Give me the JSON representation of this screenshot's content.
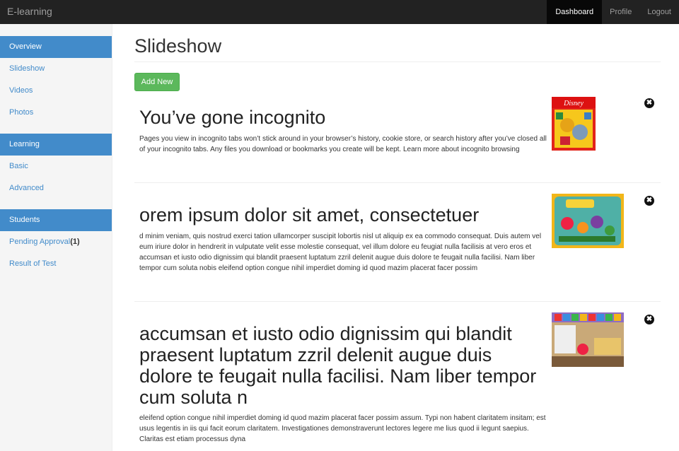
{
  "navbar": {
    "brand": "E-learning",
    "items": [
      {
        "label": "Dashboard",
        "active": true
      },
      {
        "label": "Profile",
        "active": false
      },
      {
        "label": "Logout",
        "active": false
      }
    ]
  },
  "sidebar": {
    "groups": [
      {
        "header": "Overview",
        "items": [
          "Slideshow",
          "Videos",
          "Photos"
        ]
      },
      {
        "header": "Learning",
        "items": [
          "Basic",
          "Advanced"
        ]
      },
      {
        "header": "Students",
        "items": [
          "Pending Approval",
          "Result of Test"
        ],
        "pending_count": "(1)"
      }
    ]
  },
  "main": {
    "title": "Slideshow",
    "add_button": "Add New",
    "close_glyph": "✖",
    "slides": [
      {
        "title": "You’ve gone incognito",
        "text": "Pages you view in incognito tabs won’t stick around in your browser’s history, cookie store, or search history after you’ve closed all of your incognito tabs. Any files you download or bookmarks you create will be kept. Learn more about incognito browsing",
        "image": "disney-winnie-the-pooh-game-thumbnail"
      },
      {
        "title": "orem ipsum dolor sit amet, consectetuer",
        "text": "d minim veniam, quis nostrud exerci tation ullamcorper suscipit lobortis nisl ut aliquip ex ea commodo consequat. Duis autem vel eum iriure dolor in hendrerit in vulputate velit esse molestie consequat, vel illum dolore eu feugiat nulla facilisis at vero eros et accumsan et iusto odio dignissim qui blandit praesent luptatum zzril delenit augue duis dolore te feugait nulla facilisi. Nam liber tempor cum soluta nobis eleifend option congue nihil imperdiet doming id quod mazim placerat facer possim",
        "image": "fungoons-cartoon-thumbnail"
      },
      {
        "title": "accumsan et iusto odio dignissim qui blandit praesent luptatum zzril delenit augue duis dolore te feugait nulla facilisi. Nam liber tempor cum soluta n",
        "text": "eleifend option congue nihil imperdiet doming id quod mazim placerat facer possim assum. Typi non habent claritatem insitam; est usus legentis in iis qui facit eorum claritatem. Investigationes demonstraverunt lectores legere me lius quod ii legunt saepius. Claritas est etiam processus dyna",
        "image": "preschool-games-thumbnail"
      }
    ]
  },
  "colors": {
    "navbar": "#222222",
    "primary": "#428bca",
    "success": "#5cb85c"
  }
}
